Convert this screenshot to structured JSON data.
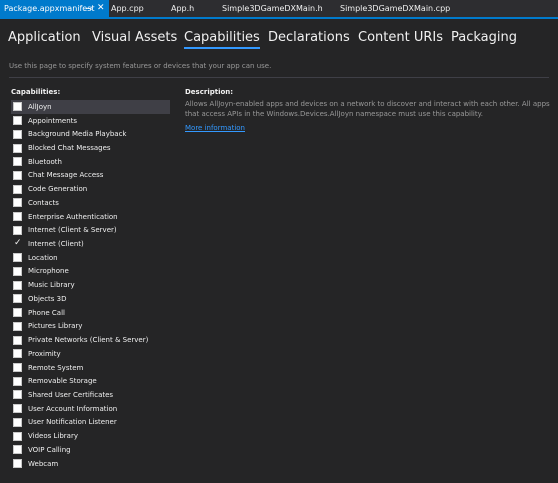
{
  "doc_tabs": [
    {
      "label": "Package.appxmanifest",
      "active": true
    },
    {
      "label": "App.cpp",
      "active": false
    },
    {
      "label": "App.h",
      "active": false
    },
    {
      "label": "Simple3DGameDXMain.h",
      "active": false
    },
    {
      "label": "Simple3DGameDXMain.cpp",
      "active": false
    }
  ],
  "icons": {
    "pin": "⊸",
    "close": "✕",
    "check": "✓"
  },
  "designer_tabs": [
    {
      "label": "Application",
      "selected": false
    },
    {
      "label": "Visual Assets",
      "selected": false
    },
    {
      "label": "Capabilities",
      "selected": true
    },
    {
      "label": "Declarations",
      "selected": false
    },
    {
      "label": "Content URIs",
      "selected": false
    },
    {
      "label": "Packaging",
      "selected": false
    }
  ],
  "hint": "Use this page to specify system features or devices that your app can use.",
  "capabilities_heading": "Capabilities:",
  "description_heading": "Description:",
  "description_text": "Allows AllJoyn-enabled apps and devices on a network to discover and interact with each other. All apps that access APIs in the Windows.Devices.AllJoyn namespace must use this capability.",
  "more_info": "More information",
  "capabilities": [
    {
      "label": "AllJoyn",
      "checked": false,
      "highlighted": true
    },
    {
      "label": "Appointments",
      "checked": false
    },
    {
      "label": "Background Media Playback",
      "checked": false
    },
    {
      "label": "Blocked Chat Messages",
      "checked": false
    },
    {
      "label": "Bluetooth",
      "checked": false
    },
    {
      "label": "Chat Message Access",
      "checked": false
    },
    {
      "label": "Code Generation",
      "checked": false
    },
    {
      "label": "Contacts",
      "checked": false
    },
    {
      "label": "Enterprise Authentication",
      "checked": false
    },
    {
      "label": "Internet (Client & Server)",
      "checked": false
    },
    {
      "label": "Internet (Client)",
      "checked": true
    },
    {
      "label": "Location",
      "checked": false
    },
    {
      "label": "Microphone",
      "checked": false
    },
    {
      "label": "Music Library",
      "checked": false
    },
    {
      "label": "Objects 3D",
      "checked": false
    },
    {
      "label": "Phone Call",
      "checked": false
    },
    {
      "label": "Pictures Library",
      "checked": false
    },
    {
      "label": "Private Networks (Client & Server)",
      "checked": false
    },
    {
      "label": "Proximity",
      "checked": false
    },
    {
      "label": "Remote System",
      "checked": false
    },
    {
      "label": "Removable Storage",
      "checked": false
    },
    {
      "label": "Shared User Certificates",
      "checked": false
    },
    {
      "label": "User Account Information",
      "checked": false
    },
    {
      "label": "User Notification Listener",
      "checked": false
    },
    {
      "label": "Videos Library",
      "checked": false
    },
    {
      "label": "VOIP Calling",
      "checked": false
    },
    {
      "label": "Webcam",
      "checked": false
    }
  ]
}
